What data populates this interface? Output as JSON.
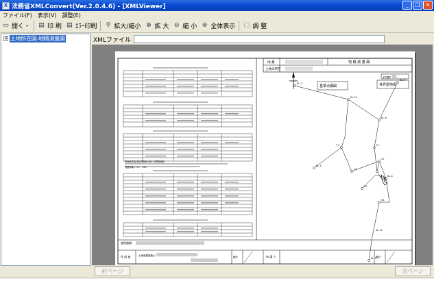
{
  "window": {
    "title": "法務省XMLConvert(Ver.2.0.4.6) - [XMLViewer]",
    "buttons": {
      "minimize": "_",
      "restore": "❐",
      "close": "✕"
    }
  },
  "menu": [
    "ファイル(F)",
    "表示(V)",
    "調整(E)"
  ],
  "toolbar": {
    "open": "開く・",
    "print": "印 刷",
    "error_print": "ｴﾗｰ印刷",
    "zoom_in_out": "拡大/縮小",
    "zoom_in": "拡 大",
    "zoom_out": "縮 小",
    "fit_all": "全体表示",
    "adjust": "調 整"
  },
  "tree": {
    "expander": "+",
    "item": "土地所在図-地積測量図"
  },
  "xml_file": {
    "label": "XMLファイル",
    "value": ""
  },
  "nav": {
    "prev": "前ページ",
    "next": "次ページ"
  },
  "document": {
    "header_labels": [
      "地 番",
      "地 積 測 量 図",
      "土地の所在"
    ],
    "page_label": "page 1/1",
    "map_title": "基準点網図",
    "survey_label": "世界測地系",
    "footer_labels": [
      "作 成 者",
      "土地家屋調査士",
      "縮尺",
      "申 請 人",
      "縮尺"
    ],
    "usage_note": "使用器械",
    "point_labels": [
      "KL-7",
      "KL-12",
      "KL-8",
      "KL-6",
      "KL-5",
      "T-2",
      "T-1",
      "T-3",
      "T-4",
      "T-5",
      "T-6",
      "KL-3",
      "KL-4",
      "KL-11"
    ],
    "extra_text": [
      "測地系変換 東京測地系 IREF 世界測地系",
      "地図情報レベル　500"
    ]
  },
  "colors": {
    "title_bar": "#0a4bd0",
    "selection": "#316ac5",
    "window_bg": "#ece9d8",
    "viewer_bg": "#808080"
  }
}
